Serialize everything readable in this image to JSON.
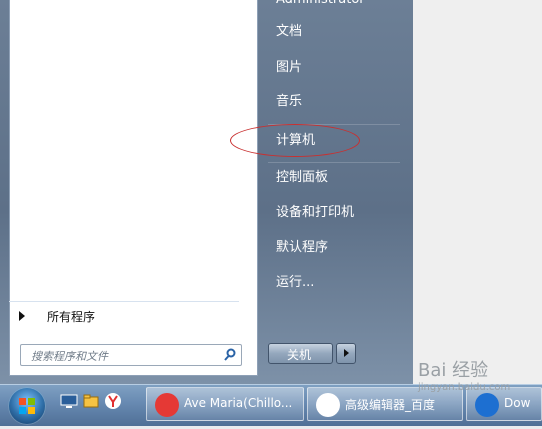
{
  "start_menu": {
    "all_programs": "所有程序",
    "search_placeholder": "搜索程序和文件",
    "right_items": [
      "Administrator",
      "文档",
      "图片",
      "音乐",
      "计算机",
      "控制面板",
      "设备和打印机",
      "默认程序",
      "运行..."
    ],
    "shutdown": "关机"
  },
  "taskbar": {
    "items": [
      {
        "label": "Ave Maria(Chillo..."
      },
      {
        "label": "高级编辑器_百度"
      },
      {
        "label": "Dow"
      }
    ]
  },
  "watermark": {
    "text": "Bai 经验",
    "url": "jingyan.baidu.com"
  },
  "colors": {
    "accent": "#2f6fa8",
    "highlight": "#c83030"
  }
}
